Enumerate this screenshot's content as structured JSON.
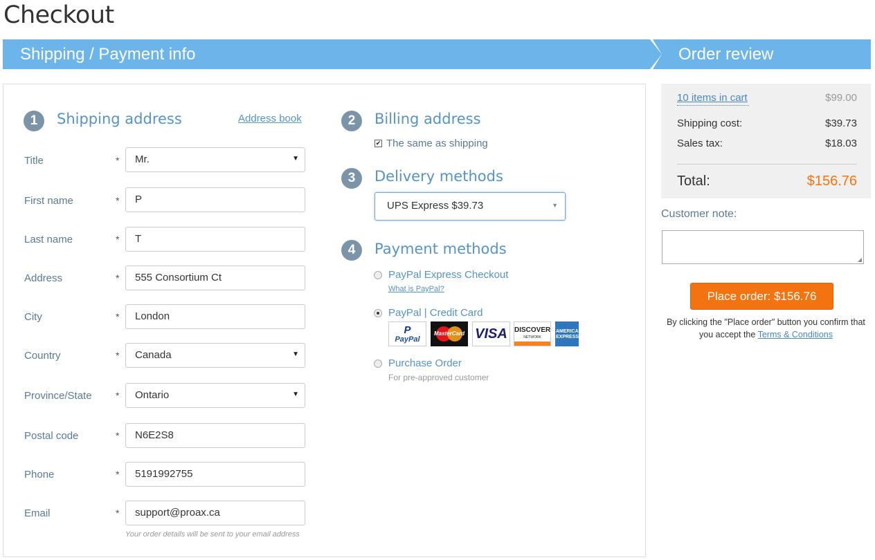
{
  "page_title": "Checkout",
  "banner": {
    "left": "Shipping / Payment info",
    "right": "Order review"
  },
  "shipping": {
    "step": "1",
    "title": "Shipping address",
    "address_book": "Address book",
    "fields": [
      {
        "label": "Title",
        "value": "Mr.",
        "type": "select"
      },
      {
        "label": "First name",
        "value": "P",
        "type": "text"
      },
      {
        "label": "Last name",
        "value": "T",
        "type": "text"
      },
      {
        "label": "Address",
        "value": "555 Consortium Ct",
        "type": "text"
      },
      {
        "label": "City",
        "value": "London",
        "type": "text"
      },
      {
        "label": "Country",
        "value": "Canada",
        "type": "select"
      },
      {
        "label": "Province/State",
        "value": "Ontario",
        "type": "select"
      },
      {
        "label": "Postal code",
        "value": "N6E2S8",
        "type": "text"
      },
      {
        "label": "Phone",
        "value": "5191992755",
        "type": "text"
      },
      {
        "label": "Email",
        "value": "support@proax.ca",
        "type": "text"
      }
    ],
    "required_mark": "*",
    "email_hint": "Your order details will be sent to your email address"
  },
  "billing": {
    "step": "2",
    "title": "Billing address",
    "same_as_shipping": "The same as shipping",
    "same_checked": true
  },
  "delivery": {
    "step": "3",
    "title": "Delivery methods",
    "selected": "UPS Express $39.73"
  },
  "payment": {
    "step": "4",
    "title": "Payment methods",
    "options": [
      {
        "label": "PayPal Express Checkout",
        "sub": "What is PayPal?",
        "selected": false
      },
      {
        "label": "PayPal | Credit Card",
        "selected": true
      },
      {
        "label": "Purchase Order",
        "sub": "For pre-approved customer",
        "selected": false
      }
    ],
    "cards": {
      "paypal": "PayPal",
      "mastercard": "MasterCard",
      "visa": "VISA",
      "discover": "DISCOVER",
      "discover_sub": "NETWORK",
      "amex": "AMERICAN EXPRESS"
    }
  },
  "summary": {
    "items": "10 items in cart",
    "items_value": "$99.00",
    "shipping_label": "Shipping cost:",
    "shipping_value": "$39.73",
    "tax_label": "Sales tax:",
    "tax_value": "$18.03",
    "total_label": "Total:",
    "total_value": "$156.76",
    "total_color": "#f2730f"
  },
  "customer_note": {
    "label": "Customer note:",
    "value": ""
  },
  "place_order": "Place order: $156.76",
  "confirm": {
    "text": "By clicking the \"Place order\" button you confirm that you accept the",
    "link": "Terms & Conditions"
  },
  "colors": {
    "accent": "#6bb5ea",
    "link": "#5693c7",
    "button": "#f2730f",
    "step_badge": "#7b94a8"
  }
}
